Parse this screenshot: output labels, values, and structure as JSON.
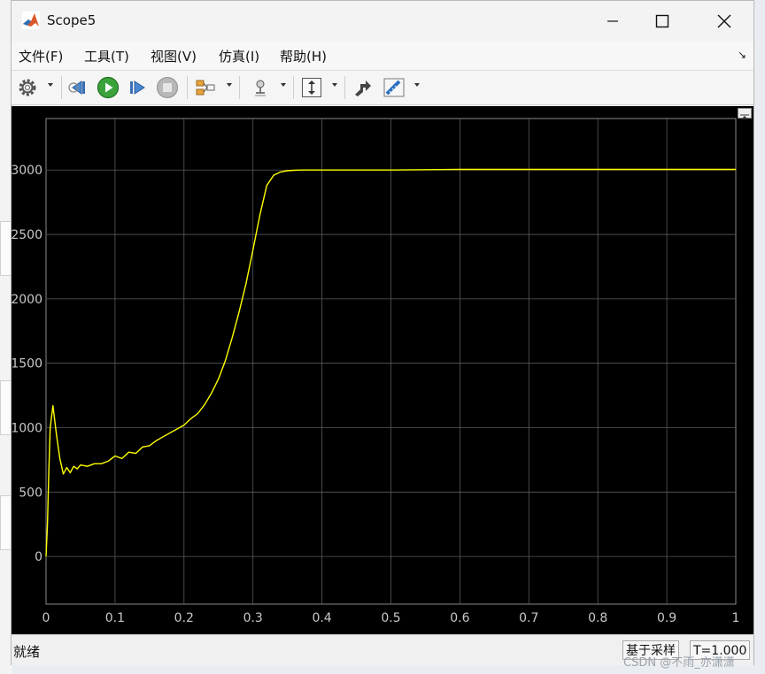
{
  "window": {
    "title": "Scope5"
  },
  "menu": {
    "items": [
      "文件(F)",
      "工具(T)",
      "视图(V)",
      "仿真(I)",
      "帮助(H)"
    ]
  },
  "toolbar": {
    "icons": [
      "gear-icon",
      "step-back-icon",
      "run-icon",
      "step-forward-icon",
      "stop-icon",
      "signal-select-icon",
      "highlight-icon",
      "autoscale-icon",
      "style-icon",
      "measure-icon"
    ]
  },
  "status": {
    "left": "就绪",
    "mode": "基于采样",
    "time": "T=1.000"
  },
  "watermark": "CSDN @不雨_亦潇潇",
  "colors": {
    "plot_bg": "#000000",
    "trace": "#ffff00",
    "grid": "#5a5a5a",
    "tick_text": "#c8c8c8"
  },
  "chart_data": {
    "type": "line",
    "title": "",
    "xlabel": "",
    "ylabel": "",
    "xlim": [
      0,
      1
    ],
    "ylim": [
      -370,
      3400
    ],
    "x_ticks": [
      0,
      0.1,
      0.2,
      0.3,
      0.4,
      0.5,
      0.6,
      0.7,
      0.8,
      0.9,
      1
    ],
    "y_ticks": [
      0,
      500,
      1000,
      1500,
      2000,
      2500,
      3000
    ],
    "grid": true,
    "series": [
      {
        "name": "",
        "color": "#ffff00",
        "x": [
          0,
          0.002,
          0.004,
          0.006,
          0.01,
          0.015,
          0.02,
          0.025,
          0.03,
          0.035,
          0.04,
          0.045,
          0.05,
          0.06,
          0.07,
          0.08,
          0.09,
          0.1,
          0.11,
          0.12,
          0.13,
          0.14,
          0.15,
          0.16,
          0.17,
          0.18,
          0.19,
          0.2,
          0.21,
          0.22,
          0.23,
          0.24,
          0.25,
          0.26,
          0.27,
          0.28,
          0.29,
          0.3,
          0.31,
          0.32,
          0.33,
          0.34,
          0.35,
          0.36,
          0.37,
          0.38,
          0.39,
          0.4,
          0.45,
          0.5,
          0.6,
          0.7,
          0.8,
          0.9,
          1.0
        ],
        "y": [
          0,
          250,
          650,
          1000,
          1170,
          950,
          760,
          640,
          690,
          650,
          700,
          680,
          710,
          700,
          720,
          720,
          740,
          780,
          760,
          810,
          800,
          850,
          860,
          900,
          930,
          960,
          990,
          1020,
          1070,
          1110,
          1180,
          1270,
          1380,
          1520,
          1700,
          1900,
          2120,
          2380,
          2650,
          2880,
          2960,
          2985,
          2995,
          2998,
          3000,
          3000,
          3000,
          3000,
          3000,
          3000,
          3005,
          3005,
          3005,
          3005,
          3005
        ]
      }
    ]
  }
}
